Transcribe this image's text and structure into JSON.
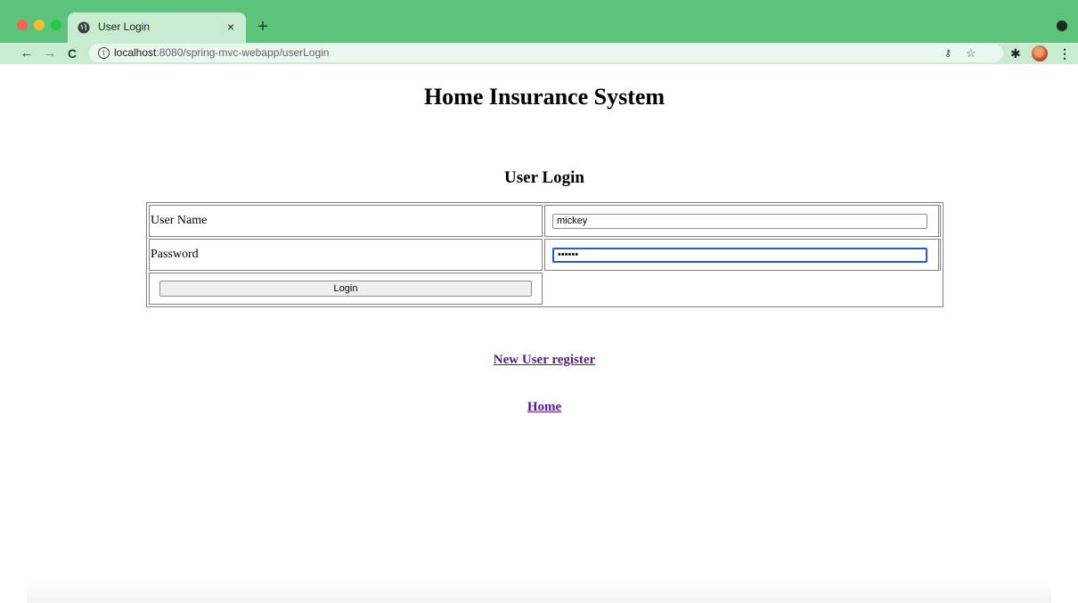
{
  "browser": {
    "tab_title": "User Login",
    "tab_close": "×",
    "new_tab": "+",
    "url_host": "localhost",
    "url_rest": ":8080/spring-mvc-webapp/userLogin",
    "icons": [
      "back-arrow-icon",
      "forward-arrow-icon",
      "reload-icon",
      "info-icon",
      "key-icon",
      "star-icon",
      "puzzle-extension-icon",
      "avatar",
      "kebab-menu-icon"
    ]
  },
  "page": {
    "site_title": "Home Insurance System",
    "section_title": "User Login",
    "form": {
      "username_label": "User Name",
      "username_value": "mickey",
      "password_label": "Password",
      "password_value": "••••••",
      "login_button": "Login"
    },
    "links": {
      "register": "New User register",
      "home": "Home"
    }
  },
  "colors": {
    "chrome_accent": "#5cc47a",
    "link_visited": "#551a8b",
    "focus_ring": "#1a5fd0"
  }
}
